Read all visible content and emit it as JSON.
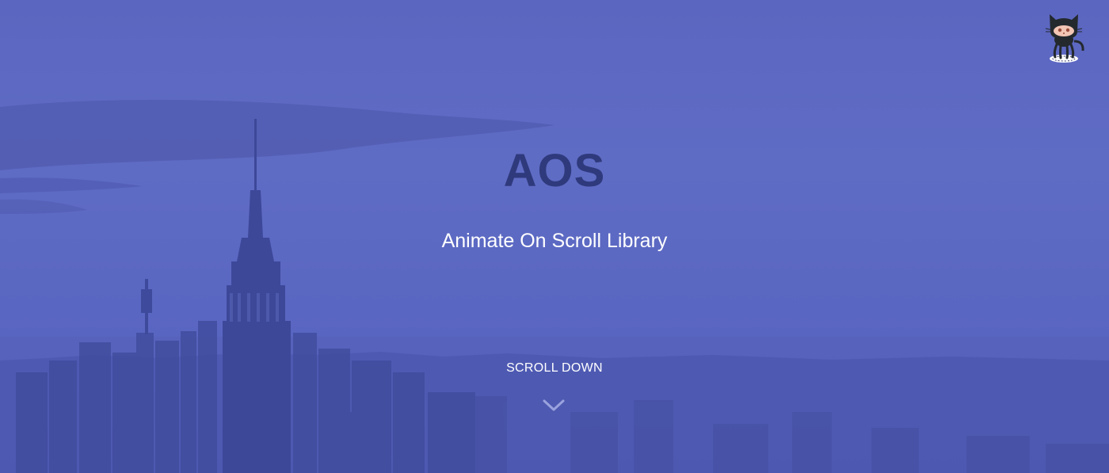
{
  "hero": {
    "title": "AOS",
    "subtitle": "Animate On Scroll Library",
    "scroll_label": "SCROLL DOWN",
    "scroll_icon": "chevron-down-icon",
    "background_color": "#5d69c2",
    "title_color": "#2f3a7d",
    "text_color": "#ffffff"
  },
  "github": {
    "icon": "octocat-icon"
  }
}
